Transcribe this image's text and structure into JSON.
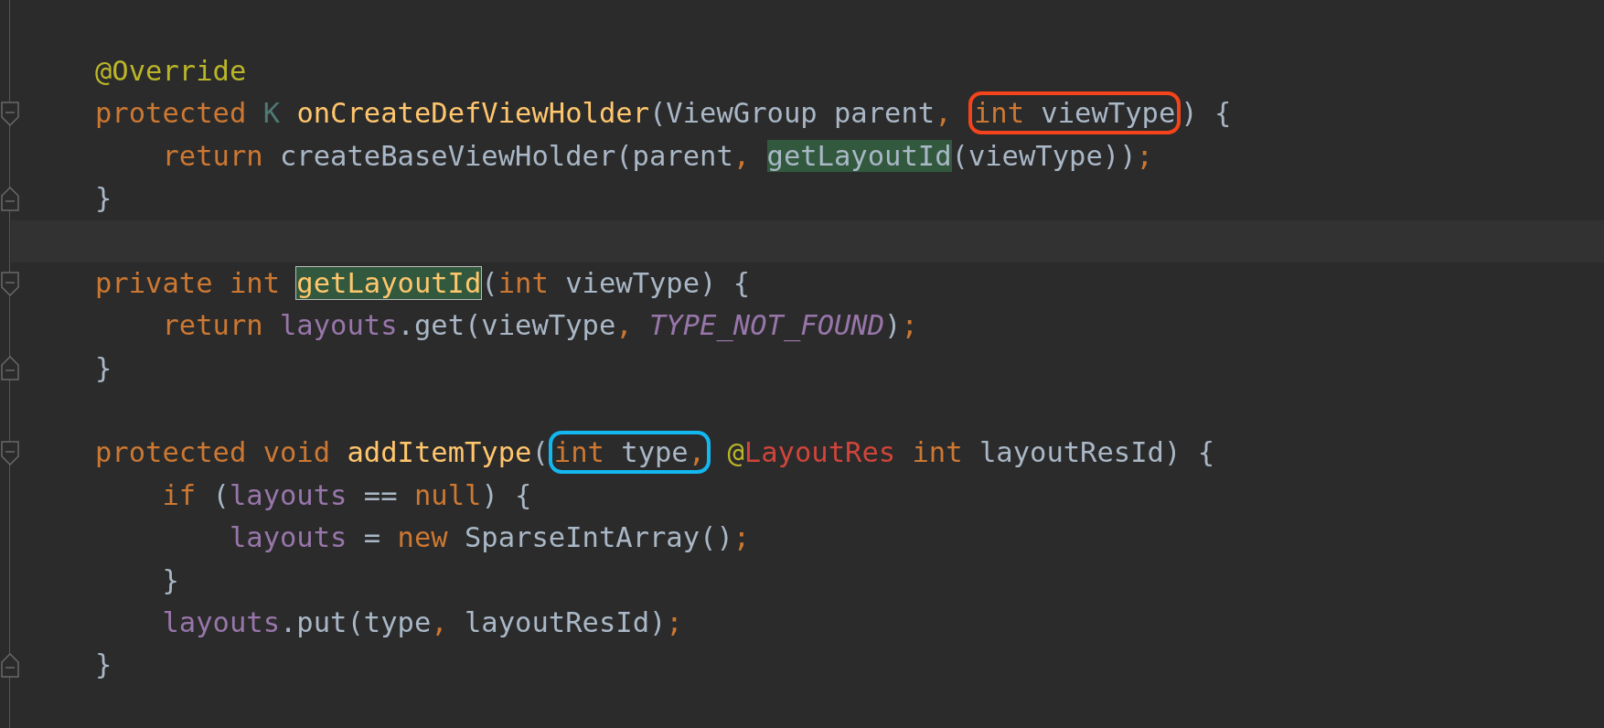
{
  "editor": {
    "lines": [
      {
        "kind": "plain",
        "tokens": [
          {
            "text": "@Override",
            "kind": "annotation"
          }
        ]
      },
      {
        "kind": "fold-start",
        "tokens": [
          {
            "text": "protected ",
            "kind": "keyword"
          },
          {
            "text": "K ",
            "kind": "typeparam"
          },
          {
            "text": "onCreateDefViewHolder",
            "kind": "method"
          },
          {
            "text": "(ViewGroup parent",
            "kind": "plain"
          },
          {
            "text": ", ",
            "kind": "punct"
          },
          {
            "kind": "box",
            "color": "#f4441c",
            "tokens": [
              {
                "text": "int ",
                "kind": "keyword"
              },
              {
                "text": "viewType",
                "kind": "plain"
              }
            ]
          },
          {
            "text": ") {",
            "kind": "plain"
          }
        ]
      },
      {
        "kind": "plain",
        "tokens": [
          {
            "text": "    return ",
            "kind": "keyword"
          },
          {
            "text": "createBaseViewHolder(parent",
            "kind": "plain"
          },
          {
            "text": ", ",
            "kind": "punct"
          },
          {
            "text": "getLayoutId",
            "kind": "plain",
            "highlighted": true
          },
          {
            "text": "(viewType))",
            "kind": "plain"
          },
          {
            "text": ";",
            "kind": "punct"
          }
        ]
      },
      {
        "kind": "fold-end",
        "tokens": [
          {
            "text": "}",
            "kind": "plain"
          }
        ]
      },
      {
        "kind": "blank",
        "current": true
      },
      {
        "kind": "fold-start",
        "tokens": [
          {
            "text": "private int ",
            "kind": "keyword"
          },
          {
            "text": "getLayoutId",
            "kind": "method",
            "highlighted": true,
            "outlined": true
          },
          {
            "text": "(",
            "kind": "plain"
          },
          {
            "text": "int ",
            "kind": "keyword"
          },
          {
            "text": "viewType) {",
            "kind": "plain"
          }
        ]
      },
      {
        "kind": "plain",
        "tokens": [
          {
            "text": "    return ",
            "kind": "keyword"
          },
          {
            "text": "layouts",
            "kind": "field"
          },
          {
            "text": ".get(viewType",
            "kind": "plain"
          },
          {
            "text": ", ",
            "kind": "punct"
          },
          {
            "text": "TYPE_NOT_FOUND",
            "kind": "constant"
          },
          {
            "text": ")",
            "kind": "plain"
          },
          {
            "text": ";",
            "kind": "punct"
          }
        ]
      },
      {
        "kind": "fold-end",
        "tokens": [
          {
            "text": "}",
            "kind": "plain"
          }
        ]
      },
      {
        "kind": "blank"
      },
      {
        "kind": "fold-start",
        "tokens": [
          {
            "text": "protected void ",
            "kind": "keyword"
          },
          {
            "text": "addItemType",
            "kind": "method"
          },
          {
            "text": "(",
            "kind": "plain"
          },
          {
            "kind": "box",
            "color": "#13b8f0",
            "tokens": [
              {
                "text": "int ",
                "kind": "keyword"
              },
              {
                "text": "type",
                "kind": "plain"
              },
              {
                "text": ",",
                "kind": "punct"
              }
            ]
          },
          {
            "text": " @",
            "kind": "annotation"
          },
          {
            "text": "LayoutRes ",
            "kind": "error"
          },
          {
            "text": "int ",
            "kind": "keyword"
          },
          {
            "text": "layoutResId) {",
            "kind": "plain"
          }
        ]
      },
      {
        "kind": "plain",
        "tokens": [
          {
            "text": "    if ",
            "kind": "keyword"
          },
          {
            "text": "(",
            "kind": "plain"
          },
          {
            "text": "layouts",
            "kind": "field"
          },
          {
            "text": " == ",
            "kind": "plain"
          },
          {
            "text": "null",
            "kind": "keyword"
          },
          {
            "text": ") {",
            "kind": "plain"
          }
        ]
      },
      {
        "kind": "plain",
        "tokens": [
          {
            "text": "        layouts",
            "kind": "field"
          },
          {
            "text": " = ",
            "kind": "plain"
          },
          {
            "text": "new ",
            "kind": "keyword"
          },
          {
            "text": "SparseIntArray()",
            "kind": "plain"
          },
          {
            "text": ";",
            "kind": "punct"
          }
        ]
      },
      {
        "kind": "plain",
        "tokens": [
          {
            "text": "    }",
            "kind": "plain"
          }
        ]
      },
      {
        "kind": "plain",
        "tokens": [
          {
            "text": "    layouts",
            "kind": "field"
          },
          {
            "text": ".put(type",
            "kind": "plain"
          },
          {
            "text": ", ",
            "kind": "punct"
          },
          {
            "text": "layoutResId)",
            "kind": "plain"
          },
          {
            "text": ";",
            "kind": "punct"
          }
        ]
      },
      {
        "kind": "fold-end",
        "tokens": [
          {
            "text": "}",
            "kind": "plain"
          }
        ]
      }
    ]
  }
}
